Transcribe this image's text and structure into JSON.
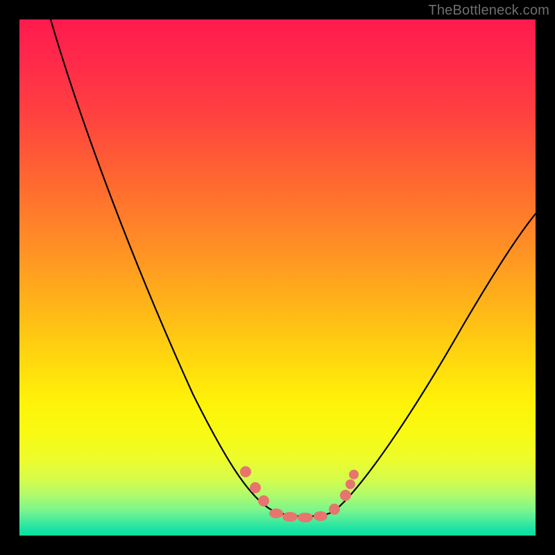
{
  "watermark": "TheBottleneck.com",
  "colors": {
    "frame": "#000000",
    "marker": "#e8746e",
    "curve": "#000000",
    "gradient_stops": [
      "#ff1a4d",
      "#ff4040",
      "#ff8f25",
      "#ffd50f",
      "#fff208",
      "#d6fc4a",
      "#3ce99e",
      "#0adf9f"
    ]
  },
  "chart_data": {
    "type": "line",
    "title": "",
    "xlabel": "",
    "ylabel": "",
    "xlim": [
      0,
      100
    ],
    "ylim": [
      0,
      100
    ],
    "grid": false,
    "legend": false,
    "note": "Heatmap background is a vertical rainbow gradient (red at top → green at bottom). Curve values are y-percentages (0 = bottom, 100 = top) read against x-percentages; both axes are unlabeled in the image.",
    "series": [
      {
        "name": "bottleneck-curve",
        "x": [
          6,
          10,
          15,
          20,
          25,
          30,
          35,
          40,
          45,
          48,
          50,
          52,
          55,
          58,
          60,
          65,
          70,
          75,
          80,
          85,
          90,
          95,
          100
        ],
        "y": [
          100,
          90,
          79,
          67,
          56,
          45,
          35,
          25,
          16,
          10,
          6,
          4,
          3,
          3,
          4,
          7,
          12,
          19,
          27,
          35,
          43,
          52,
          59
        ]
      }
    ],
    "markers": {
      "name": "highlighted-points",
      "shape": "circle",
      "color": "#e8746e",
      "x": [
        45,
        47,
        49,
        51,
        53,
        55,
        57,
        59,
        62,
        63,
        64
      ],
      "y": [
        13,
        9,
        6,
        4,
        3,
        3,
        3,
        4,
        7,
        9,
        11
      ]
    }
  }
}
